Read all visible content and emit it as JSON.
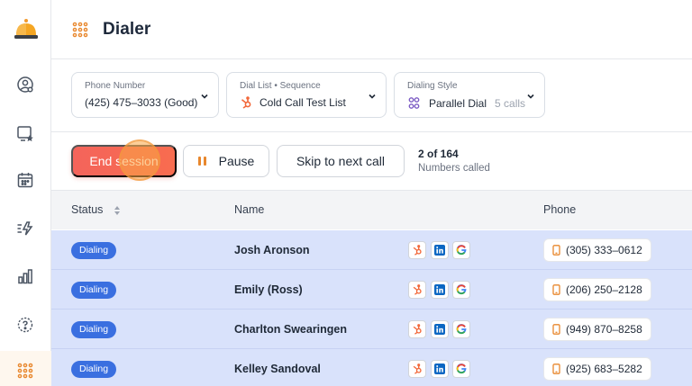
{
  "header": {
    "title": "Dialer"
  },
  "sidebar": {
    "icons": [
      "bell-logo-icon",
      "user-circle-icon",
      "board-star-icon",
      "calendar-icon",
      "lightning-list-icon",
      "bar-chart-icon",
      "help-gear-icon",
      "dialpad-icon"
    ],
    "active": "dialpad-icon"
  },
  "selectors": {
    "phone": {
      "label": "Phone Number",
      "value": "(425) 475–3033 (Good)"
    },
    "list": {
      "label": "Dial List • Sequence",
      "value": "Cold Call Test List"
    },
    "style": {
      "label": "Dialing Style",
      "value": "Parallel Dial",
      "extra": "5 calls"
    }
  },
  "actions": {
    "end_label": "End session",
    "pause_label": "Pause",
    "skip_label": "Skip to next call"
  },
  "progress": {
    "count": "2 of 164",
    "label": "Numbers called"
  },
  "table": {
    "columns": {
      "status": "Status",
      "name": "Name",
      "phone": "Phone"
    },
    "rows": [
      {
        "status": "Dialing",
        "name": "Josh Aronson",
        "phone": "(305) 333–0612"
      },
      {
        "status": "Dialing",
        "name": "Emily (Ross)",
        "phone": "(206) 250–2128"
      },
      {
        "status": "Dialing",
        "name": "Charlton Swearingen",
        "phone": "(949) 870–8258"
      },
      {
        "status": "Dialing",
        "name": "Kelley Sandoval",
        "phone": "(925) 683–5282"
      }
    ]
  },
  "colors": {
    "accent": "#F4645B",
    "badge": "#3A6FE0",
    "row_highlight": "#D9E2FB",
    "icon_orange": "#E8872D"
  }
}
